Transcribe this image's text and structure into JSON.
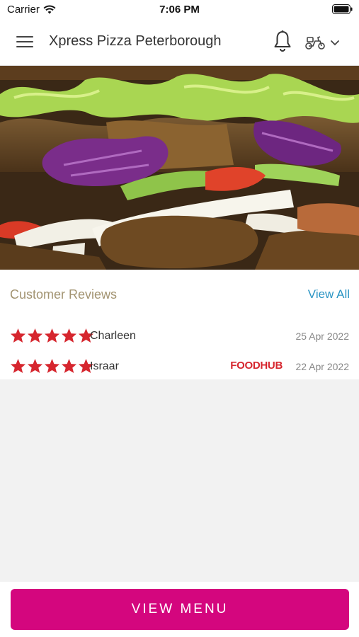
{
  "status_bar": {
    "carrier": "Carrier",
    "time": "7:06 PM",
    "icons": [
      "wifi-icon",
      "battery-icon"
    ]
  },
  "header": {
    "title": "Xpress Pizza Peterborough",
    "icons": [
      "hamburger-menu-icon",
      "bell-icon",
      "scooter-icon",
      "chevron-down-icon"
    ]
  },
  "hero": {
    "image": "kebab-photo"
  },
  "reviews": {
    "title": "Customer Reviews",
    "view_all": "View All",
    "items": [
      {
        "rating": 5,
        "name": "Charleen",
        "source": "",
        "date": "25 Apr 2022"
      },
      {
        "rating": 5,
        "name": "Israar",
        "source": "FOODHUB",
        "date": "22 Apr 2022"
      }
    ]
  },
  "footer": {
    "button_label": "VIEW MENU"
  },
  "colors": {
    "accent": "#d4067e",
    "star": "#d6262e",
    "link": "#2b95c4",
    "section_title": "#a39472",
    "source_logo": "#d6262e"
  }
}
